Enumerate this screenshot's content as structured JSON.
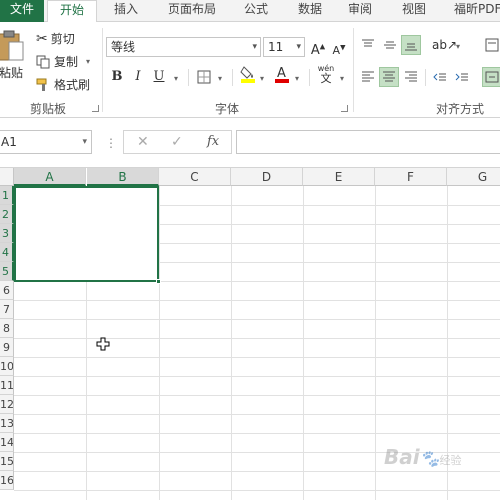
{
  "tabs": {
    "file": "文件",
    "home": "开始",
    "insert": "插入",
    "layout": "页面布局",
    "formulas": "公式",
    "data": "数据",
    "review": "审阅",
    "view": "视图",
    "foxit": "福昕PDF"
  },
  "clipboard": {
    "paste": "粘贴",
    "cut": "剪切",
    "copy": "复制",
    "format_painter": "格式刷",
    "label": "剪贴板"
  },
  "font": {
    "name": "等线",
    "size": "11",
    "bold": "B",
    "italic": "I",
    "underline": "U",
    "wen": "wén",
    "wen_char": "文",
    "label": "字体"
  },
  "alignment": {
    "label": "对齐方式"
  },
  "formula_bar": {
    "name_box": "A1",
    "fx": "fx"
  },
  "grid": {
    "columns": [
      "A",
      "B",
      "C",
      "D",
      "E",
      "F",
      "G"
    ],
    "rows": [
      "1",
      "2",
      "3",
      "4",
      "5",
      "6",
      "7",
      "8",
      "9",
      "10",
      "11",
      "12",
      "13",
      "14",
      "15",
      "16"
    ],
    "selected_range": "A1:B5"
  },
  "watermark": {
    "brand": "Bai",
    "suffix": "经验"
  },
  "colors": {
    "accent": "#217346",
    "highlight_yellow": "#ffff00",
    "font_red": "#e00000"
  }
}
